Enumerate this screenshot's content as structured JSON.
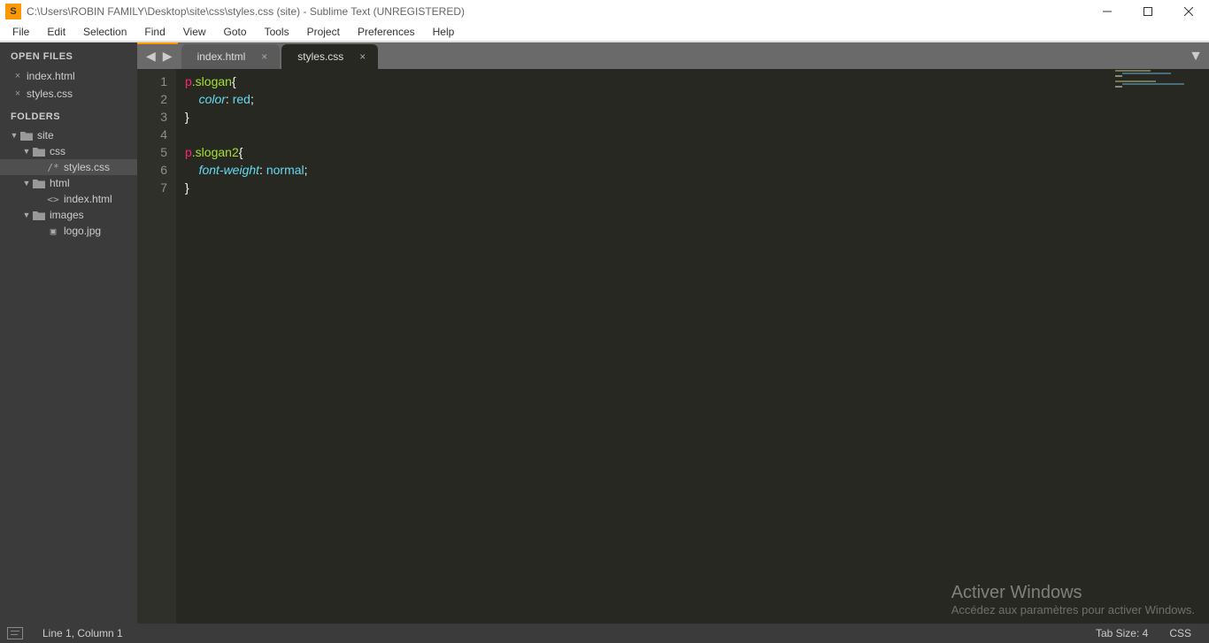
{
  "titlebar": {
    "path": "C:\\Users\\ROBIN FAMILY\\Desktop\\site\\css\\styles.css (site) - Sublime Text (UNREGISTERED)",
    "appicon_letter": "S"
  },
  "menu": [
    "File",
    "Edit",
    "Selection",
    "Find",
    "View",
    "Goto",
    "Tools",
    "Project",
    "Preferences",
    "Help"
  ],
  "sidebar": {
    "open_files_header": "OPEN FILES",
    "open_files": [
      "index.html",
      "styles.css"
    ],
    "folders_header": "FOLDERS",
    "tree": [
      {
        "depth": 1,
        "kind": "folder",
        "label": "site",
        "expanded": true
      },
      {
        "depth": 2,
        "kind": "folder",
        "label": "css",
        "expanded": true
      },
      {
        "depth": 3,
        "kind": "file",
        "label": "styles.css",
        "icon": "/*",
        "selected": true
      },
      {
        "depth": 2,
        "kind": "folder",
        "label": "html",
        "expanded": true
      },
      {
        "depth": 3,
        "kind": "file",
        "label": "index.html",
        "icon": "<>"
      },
      {
        "depth": 2,
        "kind": "folder",
        "label": "images",
        "expanded": true
      },
      {
        "depth": 3,
        "kind": "file",
        "label": "logo.jpg",
        "icon": "▣"
      }
    ]
  },
  "tabs": {
    "items": [
      {
        "label": "index.html",
        "active": false
      },
      {
        "label": "styles.css",
        "active": true
      }
    ]
  },
  "code": {
    "lines": [
      [
        {
          "t": "p",
          "c": "tok-tag"
        },
        {
          "t": ".slogan",
          "c": "tok-class"
        },
        {
          "t": "{",
          "c": "tok-punc"
        }
      ],
      [
        {
          "t": "    ",
          "c": ""
        },
        {
          "t": "color",
          "c": "tok-prop"
        },
        {
          "t": ": ",
          "c": "tok-punc"
        },
        {
          "t": "red",
          "c": "tok-val"
        },
        {
          "t": ";",
          "c": "tok-punc"
        }
      ],
      [
        {
          "t": "}",
          "c": "tok-punc"
        }
      ],
      [],
      [
        {
          "t": "p",
          "c": "tok-tag"
        },
        {
          "t": ".slogan2",
          "c": "tok-class"
        },
        {
          "t": "{",
          "c": "tok-punc"
        }
      ],
      [
        {
          "t": "    ",
          "c": ""
        },
        {
          "t": "font-weight",
          "c": "tok-prop"
        },
        {
          "t": ": ",
          "c": "tok-punc"
        },
        {
          "t": "normal",
          "c": "tok-val"
        },
        {
          "t": ";",
          "c": "tok-punc"
        }
      ],
      [
        {
          "t": "}",
          "c": "tok-punc"
        }
      ]
    ]
  },
  "watermark": {
    "line1": "Activer Windows",
    "line2": "Accédez aux paramètres pour activer Windows."
  },
  "statusbar": {
    "position": "Line 1, Column 1",
    "tabsize": "Tab Size: 4",
    "syntax": "CSS"
  }
}
